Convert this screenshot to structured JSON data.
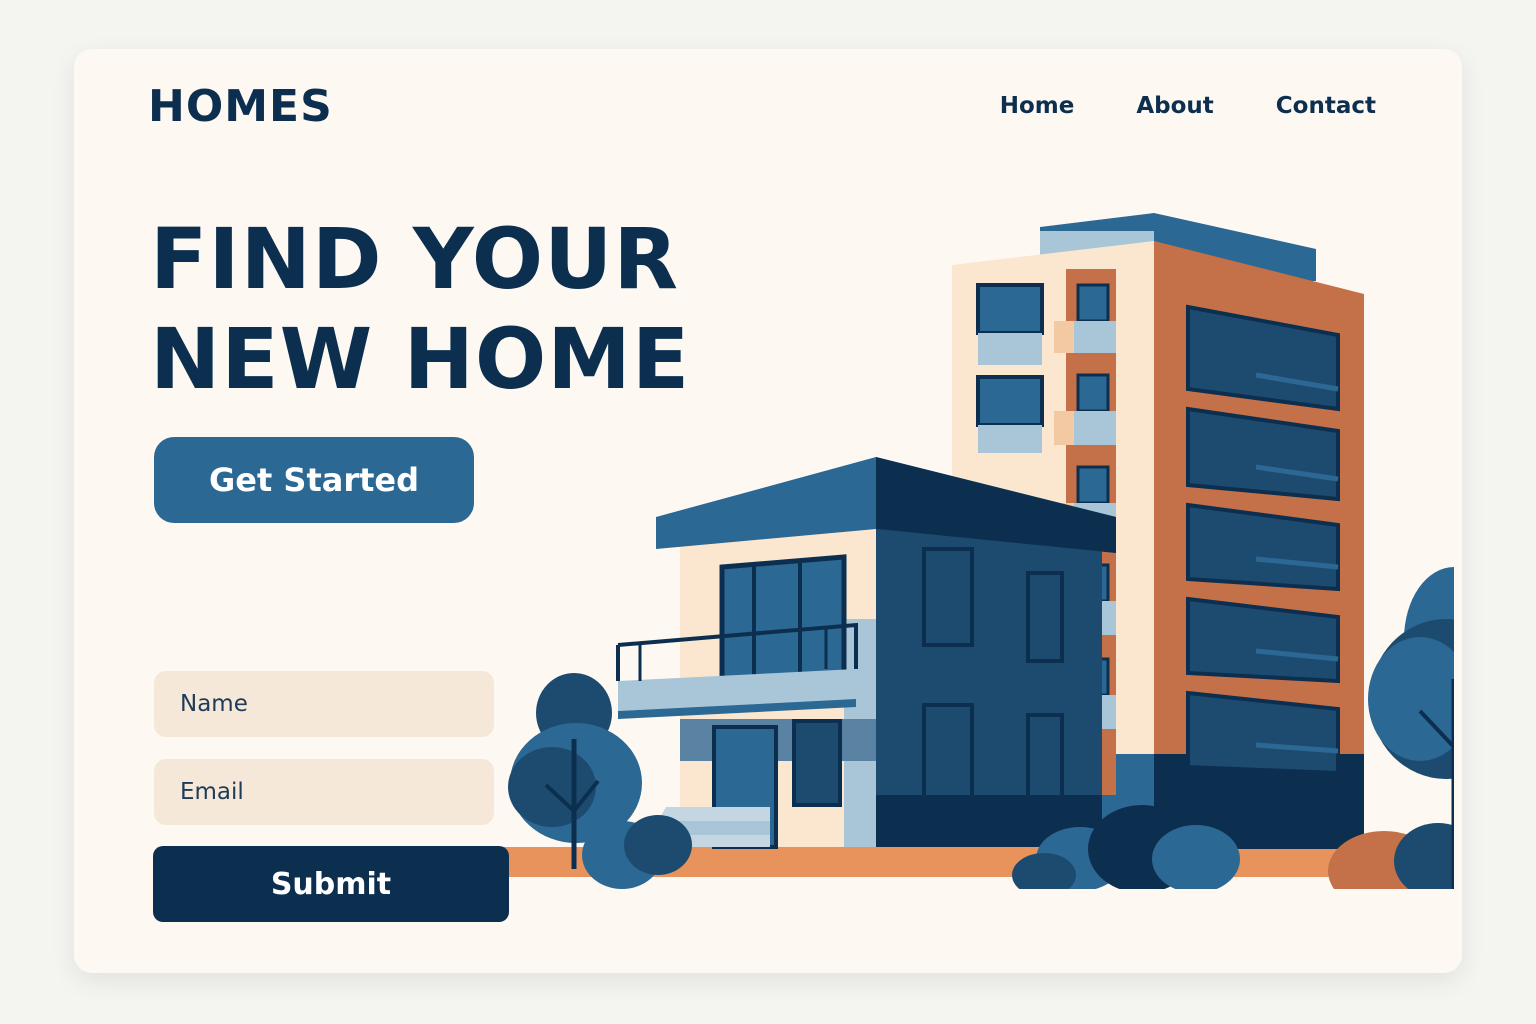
{
  "header": {
    "logo": "HOMES",
    "nav": [
      {
        "label": "Home"
      },
      {
        "label": "About"
      },
      {
        "label": "Contact"
      }
    ]
  },
  "hero": {
    "title_line1": "FIND YOUR",
    "title_line2": "NEW HOME",
    "cta_label": "Get Started"
  },
  "form": {
    "name_placeholder": "Name",
    "email_placeholder": "Email",
    "submit_label": "Submit"
  },
  "illustration": {
    "icon": "buildings-illustration",
    "colors": {
      "navy": "#0d2f4f",
      "blue": "#2c6894",
      "light_blue": "#a9c6d9",
      "cream": "#fbe7cf",
      "orange": "#c4714a",
      "ground": "#e8935c"
    }
  }
}
